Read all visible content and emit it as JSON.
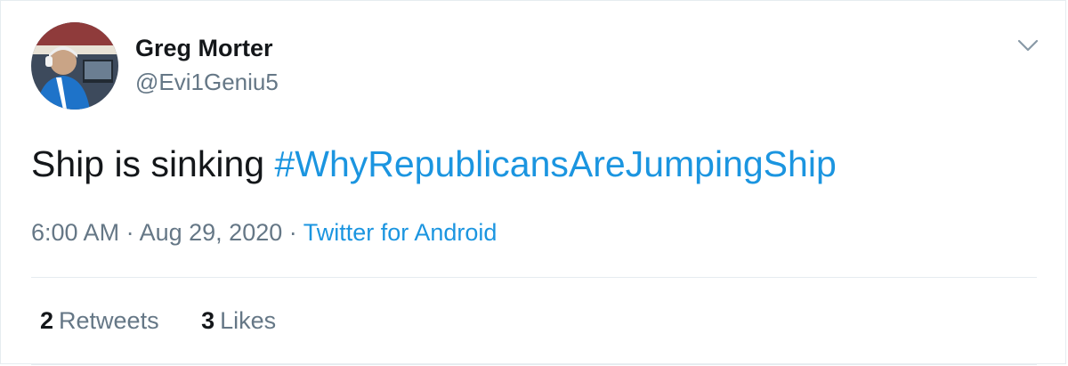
{
  "user": {
    "name": "Greg Morter",
    "handle": "@Evi1Geniu5"
  },
  "tweet": {
    "text": "Ship is sinking ",
    "hashtag": "#WhyRepublicansAreJumpingShip",
    "time": "6:00 AM",
    "separator": "·",
    "date": "Aug 29, 2020",
    "source": "Twitter for Android"
  },
  "stats": {
    "retweets_count": "2",
    "retweets_label": "Retweets",
    "likes_count": "3",
    "likes_label": "Likes"
  },
  "colors": {
    "link": "#1b95e0",
    "secondary_text": "#657786",
    "primary_text": "#14171a",
    "divider": "#e6ecf0"
  },
  "icons": {
    "more": "chevron-down-icon",
    "avatar": "avatar"
  }
}
